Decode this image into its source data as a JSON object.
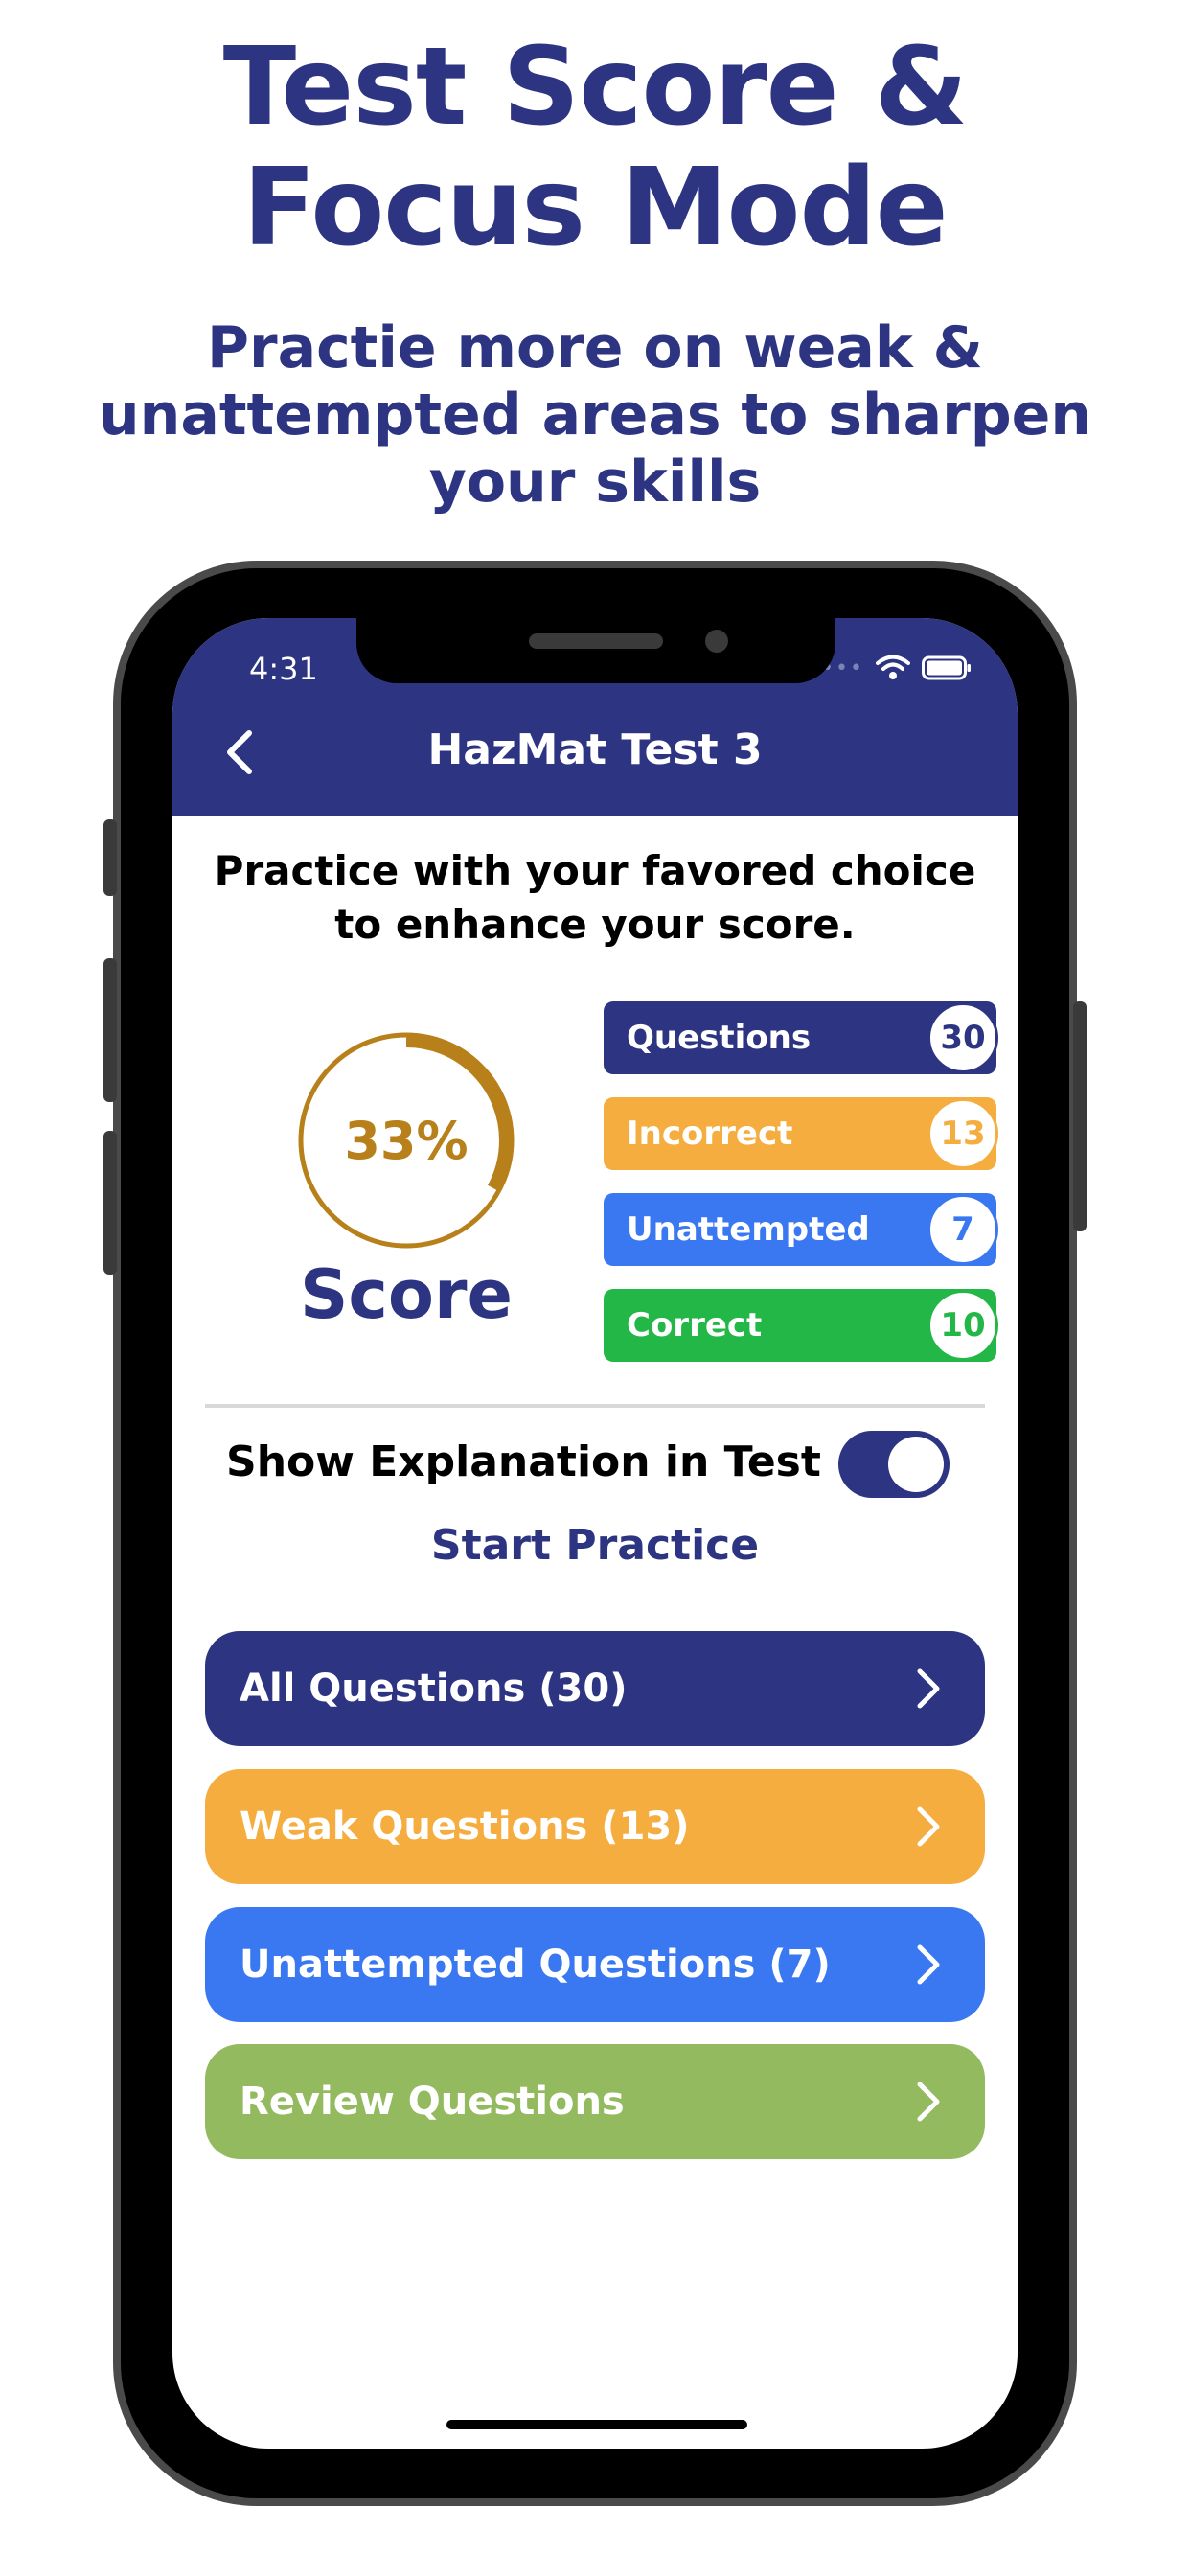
{
  "marketing": {
    "title_line1": "Test Score &",
    "title_line2": "Focus Mode",
    "subtitle": "Practie more on weak & unattempted areas to sharpen your skills"
  },
  "status_bar": {
    "time": "4:31"
  },
  "header": {
    "title": "HazMat Test 3"
  },
  "tagline": "Practice with your favored choice to enhance your score.",
  "score": {
    "percent_text": "33%",
    "percent_value": 33,
    "label": "Score"
  },
  "stats": [
    {
      "label": "Questions",
      "count": "30",
      "color": "#2d3582"
    },
    {
      "label": "Incorrect",
      "count": "13",
      "color": "#f4ad3e"
    },
    {
      "label": "Unattempted",
      "count": "7",
      "color": "#3a78f2"
    },
    {
      "label": "Correct",
      "count": "10",
      "color": "#22b746"
    }
  ],
  "settings": {
    "show_explanation_label": "Show Explanation in Test",
    "show_explanation_on": true
  },
  "start_practice_label": "Start Practice",
  "actions": [
    {
      "label": "All Questions (30)",
      "color": "#2d3582"
    },
    {
      "label": "Weak Questions (13)",
      "color": "#f4ad3e"
    },
    {
      "label": "Unattempted Questions (7)",
      "color": "#3a78f2"
    },
    {
      "label": "Review Questions",
      "color": "#93ba5e"
    }
  ],
  "colors": {
    "brand": "#2d3582",
    "score_ring": "#b7801a"
  },
  "icons": {
    "back": "chevron-left-icon",
    "wifi": "wifi-icon",
    "battery": "battery-icon",
    "action": "chevron-right-icon"
  }
}
